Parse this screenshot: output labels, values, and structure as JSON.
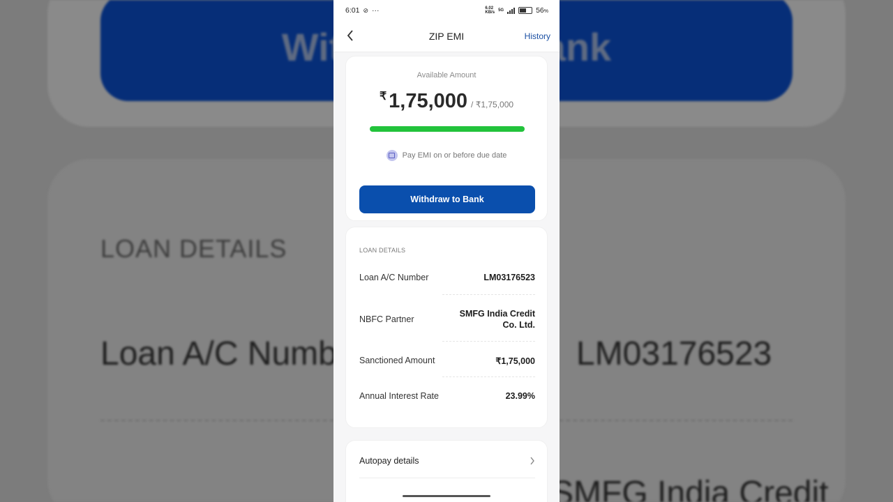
{
  "background": {
    "button_text": "Withdraw to Bank",
    "heading": "LOAN DETAILS",
    "loan_label": "Loan A/C Number",
    "loan_value": "LM03176523",
    "nbfc_value": "SMFG India Credit"
  },
  "status_bar": {
    "time": "6:01",
    "net_speed_top": "6.02",
    "net_speed_bottom": "KB/s",
    "network": "5G",
    "battery": "56",
    "battery_unit": "%",
    "more": "···"
  },
  "app_bar": {
    "title": "ZIP EMI",
    "history": "History",
    "back_icon": "chevron-left-icon"
  },
  "available": {
    "label": "Available Amount",
    "currency": "₹",
    "amount": "1,75,000",
    "total": "/ ₹1,75,000",
    "progress_fraction": 1.0,
    "progress_color": "#22c33b",
    "note": "Pay EMI on or before due date",
    "withdraw_button": "Withdraw to Bank",
    "button_color": "#0a4fad"
  },
  "loan_details": {
    "heading": "LOAN DETAILS",
    "rows": [
      {
        "label": "Loan A/C Number",
        "value": "LM03176523"
      },
      {
        "label": "NBFC Partner",
        "value": "SMFG India Credit Co. Ltd."
      },
      {
        "label": "Sanctioned Amount",
        "value": "₹1,75,000"
      },
      {
        "label": "Annual Interest Rate",
        "value": "23.99%"
      }
    ]
  },
  "autopay": {
    "label": "Autopay details",
    "icon": "chevron-right-icon"
  }
}
